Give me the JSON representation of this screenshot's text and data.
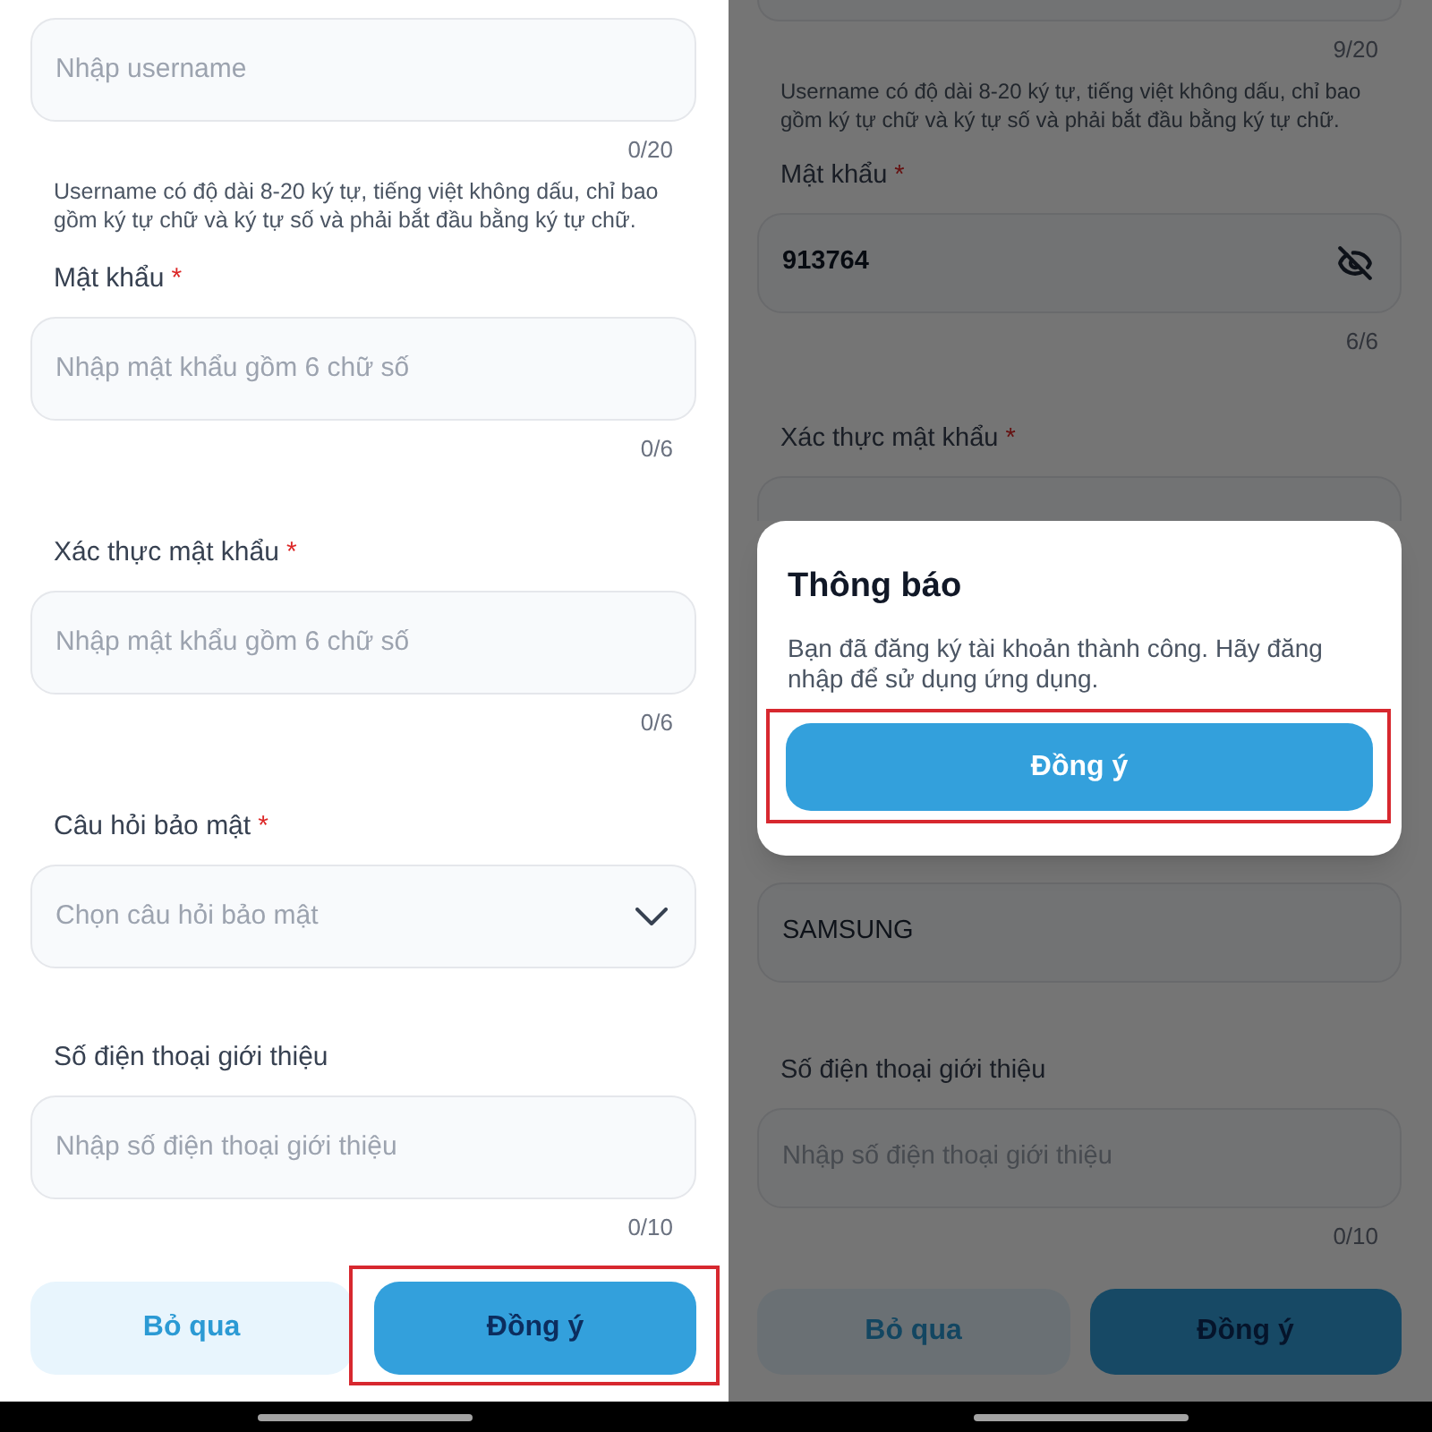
{
  "screens": [
    {
      "fields": [
        {
          "kind": "text",
          "placeholder": "Nhập username",
          "counter": "0/20",
          "hint": "Username có độ dài 8-20 ký tự, tiếng việt không dấu, chỉ bao gồm ký tự chữ và ký tự số và phải bắt đầu bằng ký tự chữ."
        },
        {
          "kind": "text",
          "label": "Mật khẩu",
          "required_mark": "*",
          "placeholder": "Nhập mật khẩu gồm 6 chữ số",
          "counter": "0/6"
        },
        {
          "kind": "text",
          "label": "Xác thực mật khẩu",
          "required_mark": "*",
          "placeholder": "Nhập mật khẩu gồm 6 chữ số",
          "counter": "0/6"
        },
        {
          "kind": "select",
          "label": "Câu hỏi bảo mật",
          "required_mark": "*",
          "placeholder": "Chọn câu hỏi bảo mật"
        },
        {
          "kind": "text",
          "label": "Số điện thoại giới thiệu",
          "placeholder": "Nhập số điện thoại giới thiệu",
          "counter": "0/10"
        }
      ],
      "buttons": [
        {
          "kind": "secondary",
          "label": "Bỏ qua",
          "highlighted": false
        },
        {
          "kind": "primary",
          "label": "Đồng ý",
          "highlighted": true
        }
      ]
    },
    {
      "fields": [
        {
          "kind": "text",
          "top_hidden": true,
          "counter": "9/20",
          "hint": "Username có độ dài 8-20 ký tự, tiếng việt không dấu, chỉ bao gồm ký tự chữ và ký tự số và phải bắt đầu bằng ký tự chữ."
        },
        {
          "kind": "password",
          "label": "Mật khẩu",
          "required_mark": "*",
          "value": "913764",
          "password_visible": true,
          "counter": "6/6"
        },
        {
          "kind": "text",
          "label": "Xác thực mật khẩu",
          "required_mark": "*",
          "bottom_hidden": true
        },
        {
          "kind": "text",
          "value": "SAMSUNG"
        },
        {
          "kind": "text",
          "label": "Số điện thoại giới thiệu",
          "placeholder": "Nhập số điện thoại giới thiệu",
          "counter": "0/10"
        }
      ],
      "dialog": {
        "title": "Thông báo",
        "message": "Bạn đã đăng ký tài khoản thành công. Hãy đăng nhập để sử dụng ứng dụng.",
        "button": {
          "label": "Đồng ý",
          "highlighted": true
        }
      },
      "buttons": [
        {
          "kind": "secondary",
          "label": "Bỏ qua",
          "highlighted": false
        },
        {
          "kind": "primary",
          "label": "Đồng ý",
          "highlighted": false
        }
      ]
    }
  ]
}
